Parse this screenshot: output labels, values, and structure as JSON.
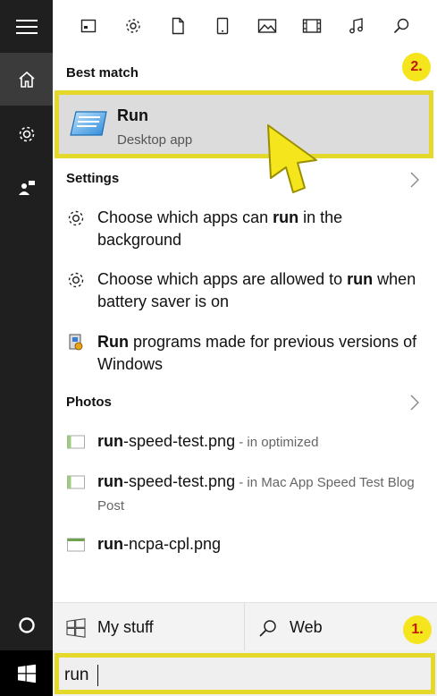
{
  "top_icons": [
    "apps-icon",
    "gear-icon",
    "document-icon",
    "tablet-icon",
    "photo-icon",
    "video-icon",
    "music-icon",
    "search-icon"
  ],
  "best_match": {
    "title": "Best match",
    "name": "Run",
    "subtitle": "Desktop app"
  },
  "settings": {
    "title": "Settings",
    "items": [
      {
        "before": "Choose which apps can ",
        "bold": "run",
        "after": " in the background"
      },
      {
        "before": "Choose which apps are allowed to ",
        "bold": "run",
        "after": " when battery saver is on"
      },
      {
        "before": "",
        "bold": "Run",
        "after": " programs made for previous versions of Windows"
      }
    ]
  },
  "photos": {
    "title": "Photos",
    "items": [
      {
        "bold": "run",
        "name": "-speed-test.png",
        "meta": " - in optimized"
      },
      {
        "bold": "run",
        "name": "-speed-test.png",
        "meta": " - in Mac App Speed Test Blog Post"
      },
      {
        "bold": "run",
        "name": "-ncpa-cpl.png",
        "meta": ""
      }
    ]
  },
  "filters": {
    "my_stuff": "My stuff",
    "web": "Web"
  },
  "search": {
    "value": "run"
  },
  "annotations": {
    "badge1": "1.",
    "badge2": "2."
  },
  "colors": {
    "highlight": "#e4d92a",
    "badge_fill": "#f4e51c",
    "badge_text": "#c21a00",
    "rail": "#1f1f1f"
  }
}
